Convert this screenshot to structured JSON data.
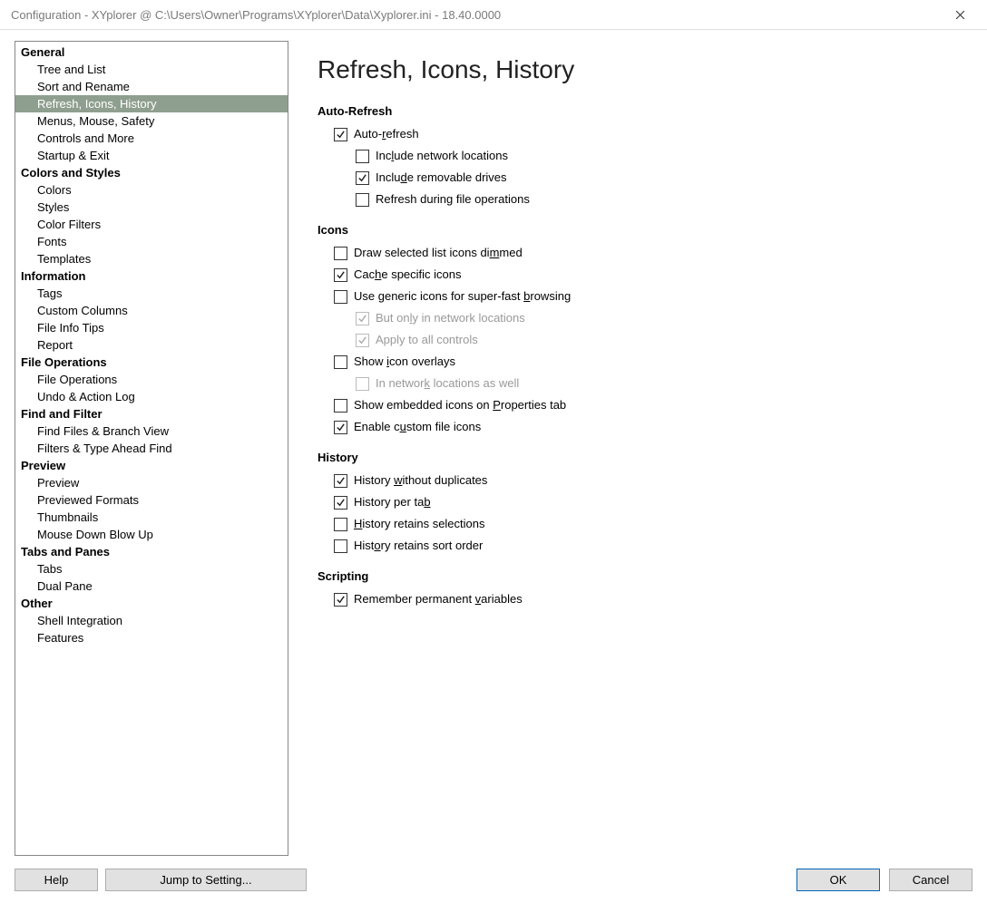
{
  "window": {
    "title": "Configuration - XYplorer @ C:\\Users\\Owner\\Programs\\XYplorer\\Data\\Xyplorer.ini - 18.40.0000"
  },
  "tree": [
    {
      "type": "cat",
      "label": "General"
    },
    {
      "type": "item",
      "label": "Tree and List"
    },
    {
      "type": "item",
      "label": "Sort and Rename"
    },
    {
      "type": "item",
      "label": "Refresh, Icons, History",
      "selected": true
    },
    {
      "type": "item",
      "label": "Menus, Mouse, Safety"
    },
    {
      "type": "item",
      "label": "Controls and More"
    },
    {
      "type": "item",
      "label": "Startup & Exit"
    },
    {
      "type": "cat",
      "label": "Colors and Styles"
    },
    {
      "type": "item",
      "label": "Colors"
    },
    {
      "type": "item",
      "label": "Styles"
    },
    {
      "type": "item",
      "label": "Color Filters"
    },
    {
      "type": "item",
      "label": "Fonts"
    },
    {
      "type": "item",
      "label": "Templates"
    },
    {
      "type": "cat",
      "label": "Information"
    },
    {
      "type": "item",
      "label": "Tags"
    },
    {
      "type": "item",
      "label": "Custom Columns"
    },
    {
      "type": "item",
      "label": "File Info Tips"
    },
    {
      "type": "item",
      "label": "Report"
    },
    {
      "type": "cat",
      "label": "File Operations"
    },
    {
      "type": "item",
      "label": "File Operations"
    },
    {
      "type": "item",
      "label": "Undo & Action Log"
    },
    {
      "type": "cat",
      "label": "Find and Filter"
    },
    {
      "type": "item",
      "label": "Find Files & Branch View"
    },
    {
      "type": "item",
      "label": "Filters & Type Ahead Find"
    },
    {
      "type": "cat",
      "label": "Preview"
    },
    {
      "type": "item",
      "label": "Preview"
    },
    {
      "type": "item",
      "label": "Previewed Formats"
    },
    {
      "type": "item",
      "label": "Thumbnails"
    },
    {
      "type": "item",
      "label": "Mouse Down Blow Up"
    },
    {
      "type": "cat",
      "label": "Tabs and Panes"
    },
    {
      "type": "item",
      "label": "Tabs"
    },
    {
      "type": "item",
      "label": "Dual Pane"
    },
    {
      "type": "cat",
      "label": "Other"
    },
    {
      "type": "item",
      "label": "Shell Integration"
    },
    {
      "type": "item",
      "label": "Features"
    }
  ],
  "page": {
    "title": "Refresh, Icons, History",
    "sections": [
      {
        "heading": "Auto-Refresh",
        "items": [
          {
            "label": "Auto-refresh",
            "u": "r",
            "checked": true,
            "indent": 0,
            "disabled": false
          },
          {
            "label": "Include network locations",
            "u": "l",
            "checked": false,
            "indent": 1,
            "disabled": false
          },
          {
            "label": "Include removable drives",
            "u": "d",
            "checked": true,
            "indent": 1,
            "disabled": false
          },
          {
            "label": "Refresh during file operations",
            "u": "",
            "checked": false,
            "indent": 1,
            "disabled": false
          }
        ]
      },
      {
        "heading": "Icons",
        "items": [
          {
            "label": "Draw selected list icons dimmed",
            "u": "m",
            "checked": false,
            "indent": 0,
            "disabled": false
          },
          {
            "label": "Cache specific icons",
            "u": "h",
            "checked": true,
            "indent": 0,
            "disabled": false
          },
          {
            "label": "Use generic icons for super-fast browsing",
            "u": "b",
            "checked": false,
            "indent": 0,
            "disabled": false
          },
          {
            "label": "But only in network locations",
            "u": "l",
            "checked": true,
            "indent": 1,
            "disabled": true
          },
          {
            "label": "Apply to all controls",
            "u": "",
            "checked": true,
            "indent": 1,
            "disabled": true
          },
          {
            "label": "Show icon overlays",
            "u": "i",
            "checked": false,
            "indent": 0,
            "disabled": false
          },
          {
            "label": "In network locations as well",
            "u": "k",
            "checked": false,
            "indent": 1,
            "disabled": true
          },
          {
            "label": "Show embedded icons on Properties tab",
            "u": "P",
            "checked": false,
            "indent": 0,
            "disabled": false
          },
          {
            "label": "Enable custom file icons",
            "u": "u",
            "checked": true,
            "indent": 0,
            "disabled": false
          }
        ]
      },
      {
        "heading": "History",
        "items": [
          {
            "label": "History without duplicates",
            "u": "w",
            "checked": true,
            "indent": 0,
            "disabled": false
          },
          {
            "label": "History per tab",
            "u": "b",
            "checked": true,
            "indent": 0,
            "disabled": false
          },
          {
            "label": "History retains selections",
            "u": "H",
            "checked": false,
            "indent": 0,
            "disabled": false
          },
          {
            "label": "History retains sort order",
            "u": "o",
            "checked": false,
            "indent": 0,
            "disabled": false
          }
        ]
      },
      {
        "heading": "Scripting",
        "items": [
          {
            "label": "Remember permanent variables",
            "u": "v",
            "checked": true,
            "indent": 0,
            "disabled": false
          }
        ]
      }
    ]
  },
  "footer": {
    "help": "Help",
    "jump": "Jump to Setting...",
    "ok": "OK",
    "cancel": "Cancel"
  }
}
